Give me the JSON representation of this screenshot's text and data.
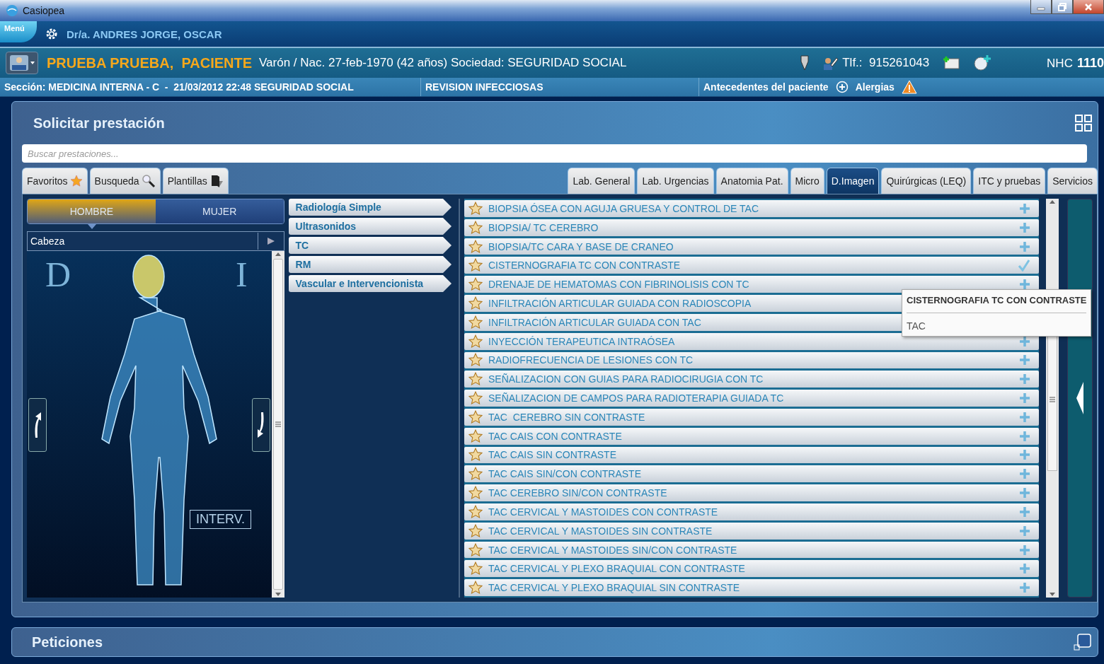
{
  "window": {
    "title": "Casiopea"
  },
  "user_bar": {
    "menu": "Menú",
    "doctor": "Dr/a. ANDRES JORGE, OSCAR"
  },
  "patient": {
    "name": "PRUEBA PRUEBA,  PACIENTE",
    "details": "Varón / Nac. 27-feb-1970 (42 años) Sociedad: SEGURIDAD SOCIAL",
    "phone": "Tlf.:  915261043",
    "nhc_label": "NHC",
    "nhc": "1110"
  },
  "section_bar": {
    "section": "Sección: MEDICINA INTERNA - C  -  21/03/2012 22:48 SEGURIDAD SOCIAL",
    "note": "REVISION INFECCIOSAS",
    "history": "Antecedentes del paciente",
    "allergies": "Alergias"
  },
  "request_panel": {
    "title": "Solicitar prestación",
    "search": {
      "placeholder": "Buscar prestaciones..."
    },
    "left_tabs": [
      {
        "label": "Favoritos",
        "selected": false
      },
      {
        "label": "Busqueda",
        "selected": false
      },
      {
        "label": "Plantillas",
        "selected": false
      }
    ],
    "right_tabs": [
      {
        "label": "Lab. General",
        "selected": false
      },
      {
        "label": "Lab. Urgencias",
        "selected": false
      },
      {
        "label": "Anatomia Pat.",
        "selected": false
      },
      {
        "label": "Micro",
        "selected": false
      },
      {
        "label": "D.Imagen",
        "selected": true
      },
      {
        "label": "Quirúrgicas (LEQ)",
        "selected": false
      },
      {
        "label": "ITC y pruebas",
        "selected": false
      },
      {
        "label": "Servicios",
        "selected": false
      }
    ],
    "gender": [
      {
        "label": "HOMBRE",
        "selected": true
      },
      {
        "label": "MUJER",
        "selected": false
      }
    ],
    "region": "Cabeza",
    "side_right": "D",
    "side_left": "I",
    "interv": "INTERV.",
    "categories": [
      "Radiología Simple",
      "Ultrasonidos",
      "TC",
      "RM",
      "Vascular e Intervencionista"
    ],
    "items": [
      {
        "label": "BIOPSIA ÓSEA CON AGUJA GRUESA Y CONTROL DE TAC",
        "added": false
      },
      {
        "label": "BIOPSIA/ TC CEREBRO",
        "added": false
      },
      {
        "label": "BIOPSIA/TC CARA Y BASE DE CRANEO",
        "added": false
      },
      {
        "label": "CISTERNOGRAFIA TC CON CONTRASTE",
        "added": true
      },
      {
        "label": "DRENAJE DE HEMATOMAS CON FIBRINOLISIS CON TC",
        "added": false
      },
      {
        "label": "INFILTRACIÓN ARTICULAR GUIADA CON RADIOSCOPIA"
      },
      {
        "label": "INFILTRACIÓN ARTICULAR GUIADA CON TAC"
      },
      {
        "label": "INYECCIÓN TERAPEUTICA INTRAÓSEA",
        "added": false
      },
      {
        "label": "RADIOFRECUENCIA DE LESIONES CON TC",
        "added": false
      },
      {
        "label": "SEÑALIZACION CON GUIAS PARA RADIOCIRUGIA CON TC",
        "added": false
      },
      {
        "label": "SEÑALIZACION DE CAMPOS PARA RADIOTERAPIA GUIADA TC",
        "added": false
      },
      {
        "label": "TAC  CEREBRO SIN CONTRASTE",
        "added": false
      },
      {
        "label": "TAC CAIS CON CONTRASTE",
        "added": false
      },
      {
        "label": "TAC CAIS SIN CONTRASTE",
        "added": false
      },
      {
        "label": "TAC CAIS SIN/CON CONTRASTE",
        "added": false
      },
      {
        "label": "TAC CEREBRO SIN/CON CONTRASTE",
        "added": false
      },
      {
        "label": "TAC CERVICAL Y MASTOIDES CON CONTRASTE",
        "added": false
      },
      {
        "label": "TAC CERVICAL Y MASTOIDES SIN CONTRASTE",
        "added": false
      },
      {
        "label": "TAC CERVICAL Y MASTOIDES SIN/CON CONTRASTE",
        "added": false
      },
      {
        "label": "TAC CERVICAL Y PLEXO BRAQUIAL CON CONTRASTE",
        "added": false
      },
      {
        "label": "TAC CERVICAL Y PLEXO BRAQUIAL SIN CONTRASTE",
        "added": false
      }
    ],
    "tooltip": {
      "title": "CISTERNOGRAFIA TC CON CONTRASTE",
      "subtitle": "TAC"
    }
  },
  "requests_panel": {
    "title": "Peticiones"
  }
}
